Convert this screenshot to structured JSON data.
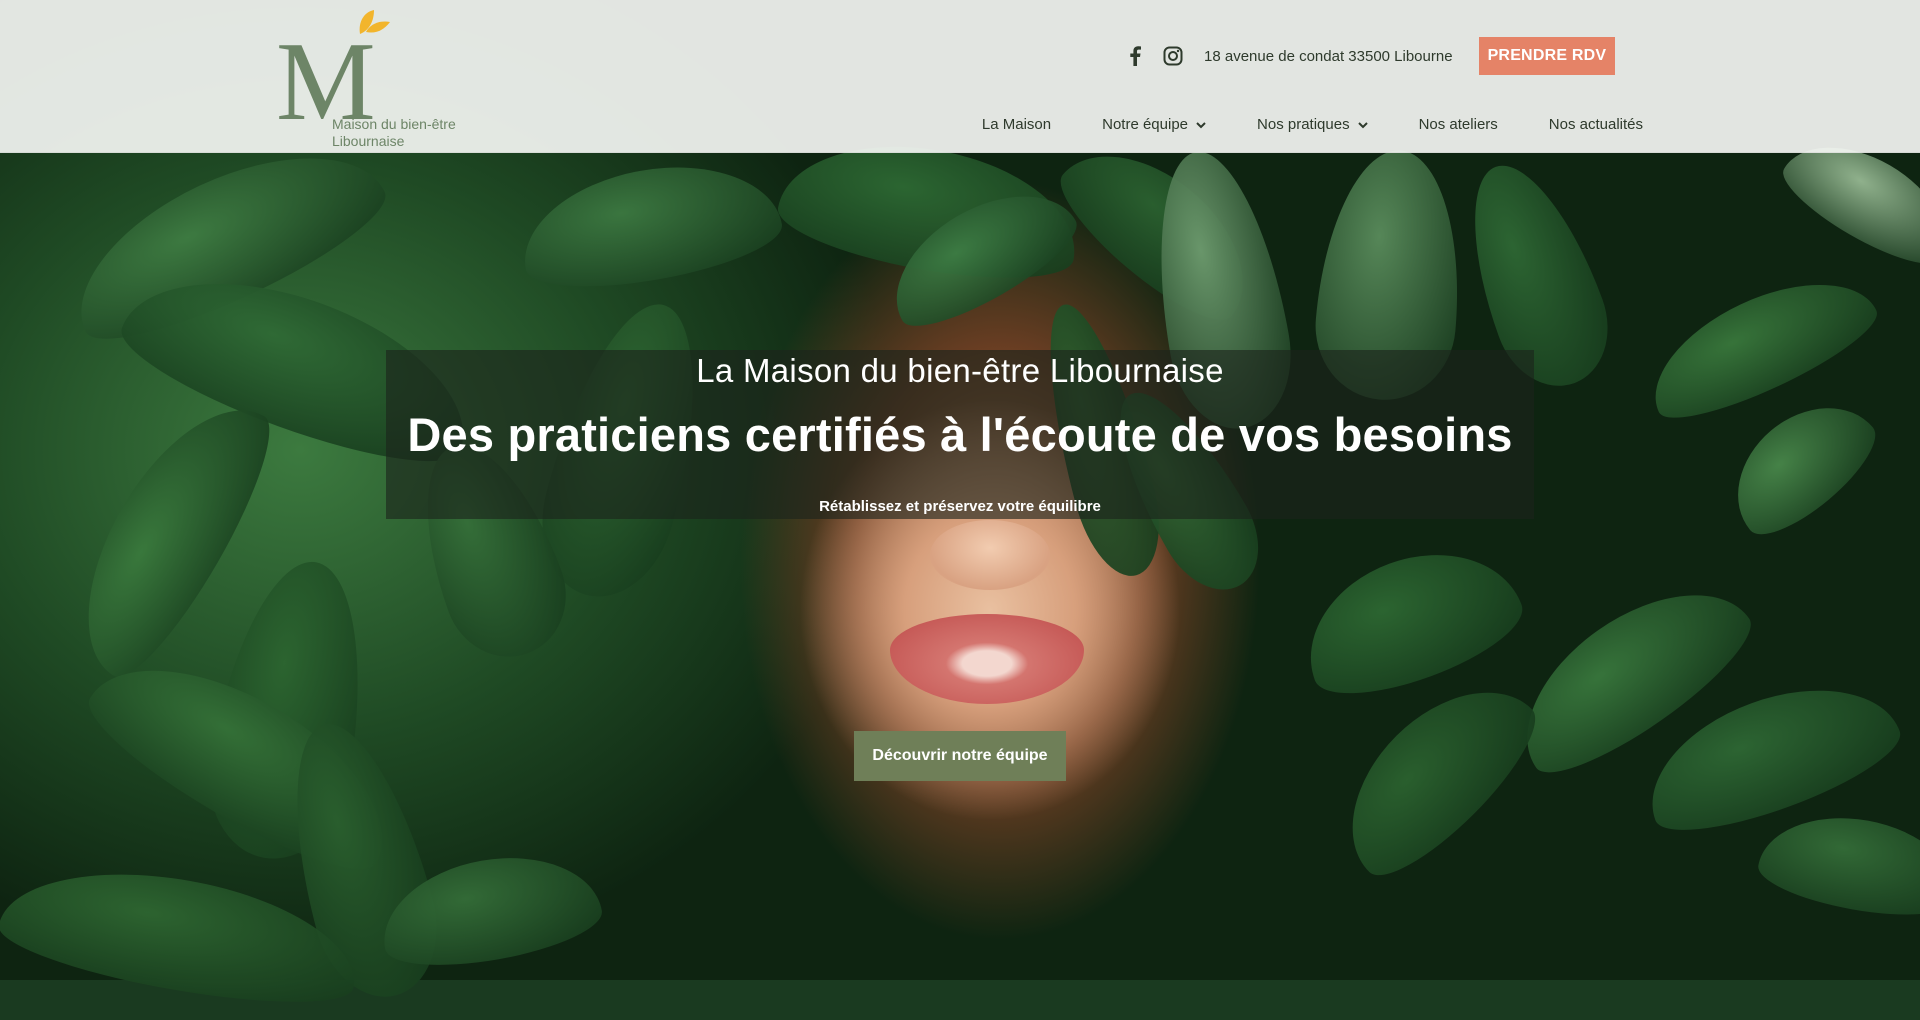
{
  "brand": {
    "logo_letter": "M",
    "name_line1": "Maison du bien-être",
    "name_line2": "Libournaise",
    "color": "#6d8567",
    "leaf_color": "#f2b52c"
  },
  "contact": {
    "facebook_icon": "facebook-icon",
    "instagram_icon": "instagram-icon",
    "address": "18 avenue de condat 33500 Libourne",
    "rdv_label": "PRENDRE RDV",
    "rdv_color": "#e58367"
  },
  "nav": {
    "items": [
      {
        "label": "La Maison",
        "dropdown": false
      },
      {
        "label": "Notre équipe",
        "dropdown": true
      },
      {
        "label": "Nos pratiques",
        "dropdown": true
      },
      {
        "label": "Nos ateliers",
        "dropdown": false
      },
      {
        "label": "Nos actualités",
        "dropdown": false
      }
    ]
  },
  "hero": {
    "subtitle": "La Maison du bien-être Libournaise",
    "title": "Des praticiens certifiés à l'écoute de vos besoins",
    "tagline": "Rétablissez et préservez votre équilibre",
    "cta_label": "Découvrir notre équipe",
    "cta_color": "#6f7f58"
  }
}
